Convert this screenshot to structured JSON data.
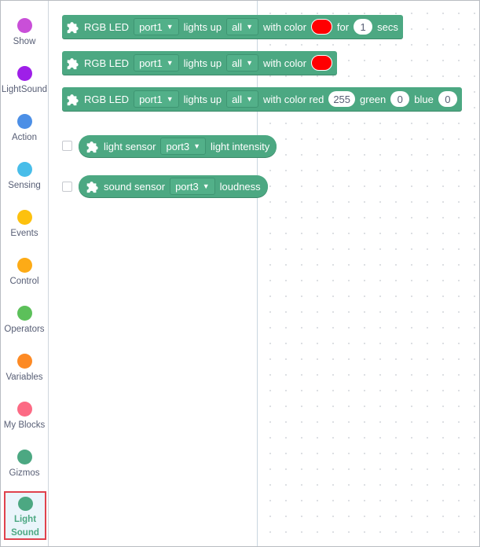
{
  "categories": [
    {
      "id": "show",
      "label": "Show",
      "color": "#c94fd8"
    },
    {
      "id": "lightsound",
      "label": "LightSound",
      "color": "#9e1fe8"
    },
    {
      "id": "action",
      "label": "Action",
      "color": "#4c8fe6"
    },
    {
      "id": "sensing",
      "label": "Sensing",
      "color": "#48bde9"
    },
    {
      "id": "events",
      "label": "Events",
      "color": "#fdc10e"
    },
    {
      "id": "control",
      "label": "Control",
      "color": "#fdab16"
    },
    {
      "id": "operators",
      "label": "Operators",
      "color": "#5cc05a"
    },
    {
      "id": "variables",
      "label": "Variables",
      "color": "#fd8a24"
    },
    {
      "id": "myblocks",
      "label": "My Blocks",
      "color": "#fc6a84"
    },
    {
      "id": "gizmos",
      "label": "Gizmos",
      "color": "#4ca882"
    },
    {
      "id": "lightsound2",
      "label": "Light Sound",
      "color": "#4ca882",
      "selected": true
    }
  ],
  "colors": {
    "block": "#4ca882",
    "led": "#ff0000"
  },
  "blocks": {
    "b1": {
      "label": "RGB LED",
      "port": "port1",
      "mid": "lights up",
      "target": "all",
      "color_label": "with color",
      "for_label": "for",
      "secs_value": "1",
      "secs_label": "secs"
    },
    "b2": {
      "label": "RGB LED",
      "port": "port1",
      "mid": "lights up",
      "target": "all",
      "color_label": "with color"
    },
    "b3": {
      "label": "RGB LED",
      "port": "port1",
      "mid": "lights up",
      "target": "all",
      "red_label": "with color red",
      "red_value": "255",
      "green_label": "green",
      "green_value": "0",
      "blue_label": "blue",
      "blue_value": "0"
    },
    "light": {
      "label": "light sensor",
      "port": "port3",
      "suffix": "light intensity"
    },
    "sound": {
      "label": "sound sensor",
      "port": "port3",
      "suffix": "loudness"
    }
  },
  "icons": {
    "block_icon": "puzzle-icon",
    "dropdown": "chevron-down-icon"
  }
}
